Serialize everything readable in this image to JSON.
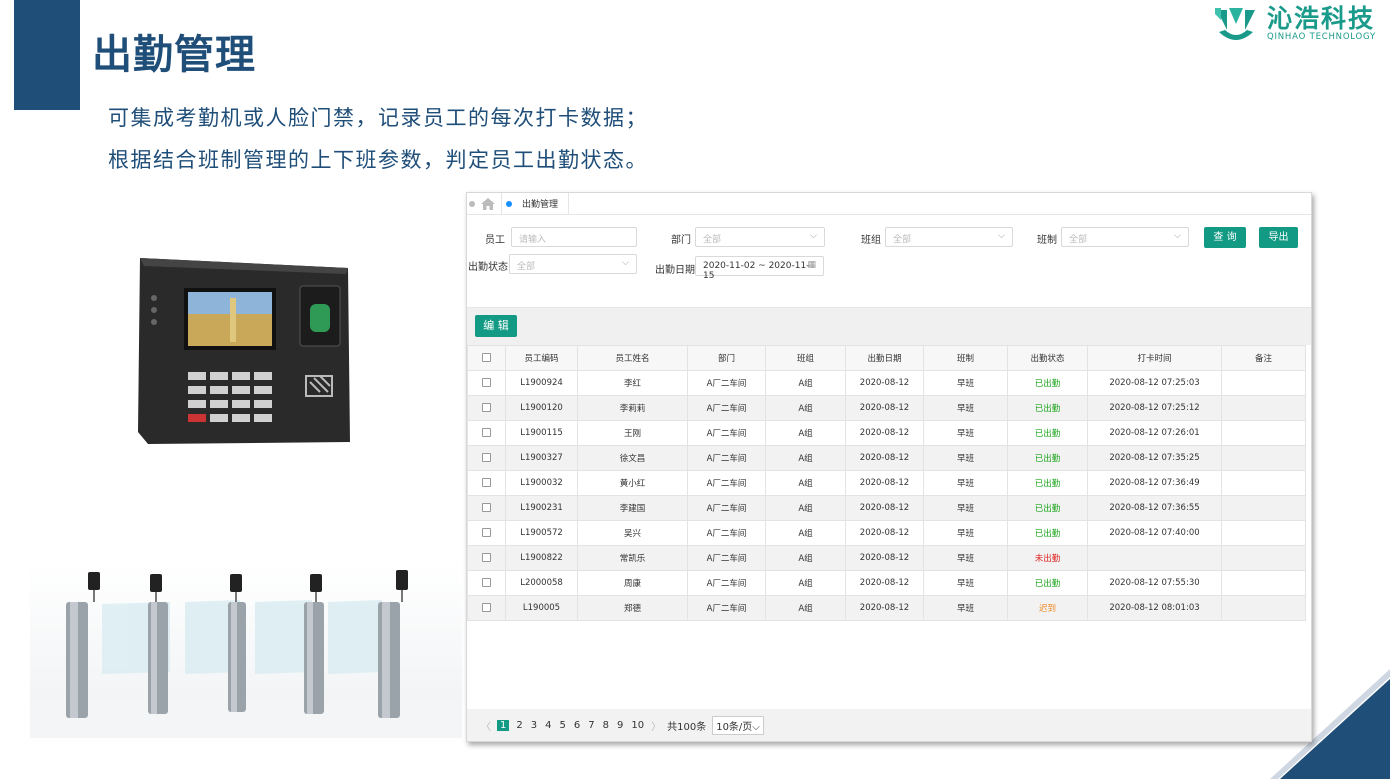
{
  "slide": {
    "title": "出勤管理",
    "desc_line1": "可集成考勤机或人脸门禁，记录员工的每次打卡数据；",
    "desc_line2": "根据结合班制管理的上下班参数，判定员工出勤状态。"
  },
  "logo": {
    "cn": "沁浩科技",
    "en": "QINHAO TECHNOLOGY"
  },
  "colors": {
    "primary": "#1f4e79",
    "accent": "#139a84",
    "ok": "#1aa51a",
    "absent": "#e02020",
    "late": "#f08a24"
  },
  "panel": {
    "breadcrumb": {
      "home_icon": "home-icon",
      "tab": "出勤管理"
    },
    "filters": {
      "employee_label": "员工",
      "employee_placeholder": "请输入",
      "dept_label": "部门",
      "dept_value": "全部",
      "group_label": "班组",
      "group_value": "全部",
      "shift_label": "班制",
      "shift_value": "全部",
      "status_label": "出勤状态",
      "status_value": "全部",
      "date_label": "出勤日期",
      "date_value": "2020-11-02 ~ 2020-11-15",
      "query_button": "查 询",
      "export_button": "导出"
    },
    "toolbar": {
      "edit_button": "编 辑"
    },
    "table": {
      "headers": [
        "员工编码",
        "员工姓名",
        "部门",
        "班组",
        "出勤日期",
        "班制",
        "出勤状态",
        "打卡时间",
        "备注"
      ],
      "rows": [
        {
          "code": "L1900924",
          "name": "李红",
          "dept": "A厂二车间",
          "group": "A组",
          "date": "2020-08-12",
          "shift": "早班",
          "status": "已出勤",
          "status_type": "ok",
          "time": "2020-08-12 07:25:03",
          "note": ""
        },
        {
          "code": "L1900120",
          "name": "李莉莉",
          "dept": "A厂二车间",
          "group": "A组",
          "date": "2020-08-12",
          "shift": "早班",
          "status": "已出勤",
          "status_type": "ok",
          "time": "2020-08-12 07:25:12",
          "note": ""
        },
        {
          "code": "L1900115",
          "name": "王刚",
          "dept": "A厂二车间",
          "group": "A组",
          "date": "2020-08-12",
          "shift": "早班",
          "status": "已出勤",
          "status_type": "ok",
          "time": "2020-08-12 07:26:01",
          "note": ""
        },
        {
          "code": "L1900327",
          "name": "徐文昌",
          "dept": "A厂二车间",
          "group": "A组",
          "date": "2020-08-12",
          "shift": "早班",
          "status": "已出勤",
          "status_type": "ok",
          "time": "2020-08-12 07:35:25",
          "note": ""
        },
        {
          "code": "L1900032",
          "name": "黄小红",
          "dept": "A厂二车间",
          "group": "A组",
          "date": "2020-08-12",
          "shift": "早班",
          "status": "已出勤",
          "status_type": "ok",
          "time": "2020-08-12 07:36:49",
          "note": ""
        },
        {
          "code": "L1900231",
          "name": "李建国",
          "dept": "A厂二车间",
          "group": "A组",
          "date": "2020-08-12",
          "shift": "早班",
          "status": "已出勤",
          "status_type": "ok",
          "time": "2020-08-12 07:36:55",
          "note": ""
        },
        {
          "code": "L1900572",
          "name": "吴兴",
          "dept": "A厂二车间",
          "group": "A组",
          "date": "2020-08-12",
          "shift": "早班",
          "status": "已出勤",
          "status_type": "ok",
          "time": "2020-08-12 07:40:00",
          "note": ""
        },
        {
          "code": "L1900822",
          "name": "常凯乐",
          "dept": "A厂二车间",
          "group": "A组",
          "date": "2020-08-12",
          "shift": "早班",
          "status": "未出勤",
          "status_type": "no",
          "time": "",
          "note": ""
        },
        {
          "code": "L2000058",
          "name": "周康",
          "dept": "A厂二车间",
          "group": "A组",
          "date": "2020-08-12",
          "shift": "早班",
          "status": "已出勤",
          "status_type": "ok",
          "time": "2020-08-12 07:55:30",
          "note": ""
        },
        {
          "code": "L190005",
          "name": "郑德",
          "dept": "A厂二车间",
          "group": "A组",
          "date": "2020-08-12",
          "shift": "早班",
          "status": "迟到",
          "status_type": "late",
          "time": "2020-08-12 08:01:03",
          "note": ""
        }
      ]
    },
    "pager": {
      "pages": [
        "1",
        "2",
        "3",
        "4",
        "5",
        "6",
        "7",
        "8",
        "9",
        "10"
      ],
      "current": "1",
      "total": "共100条",
      "page_size": "10条/页"
    }
  }
}
